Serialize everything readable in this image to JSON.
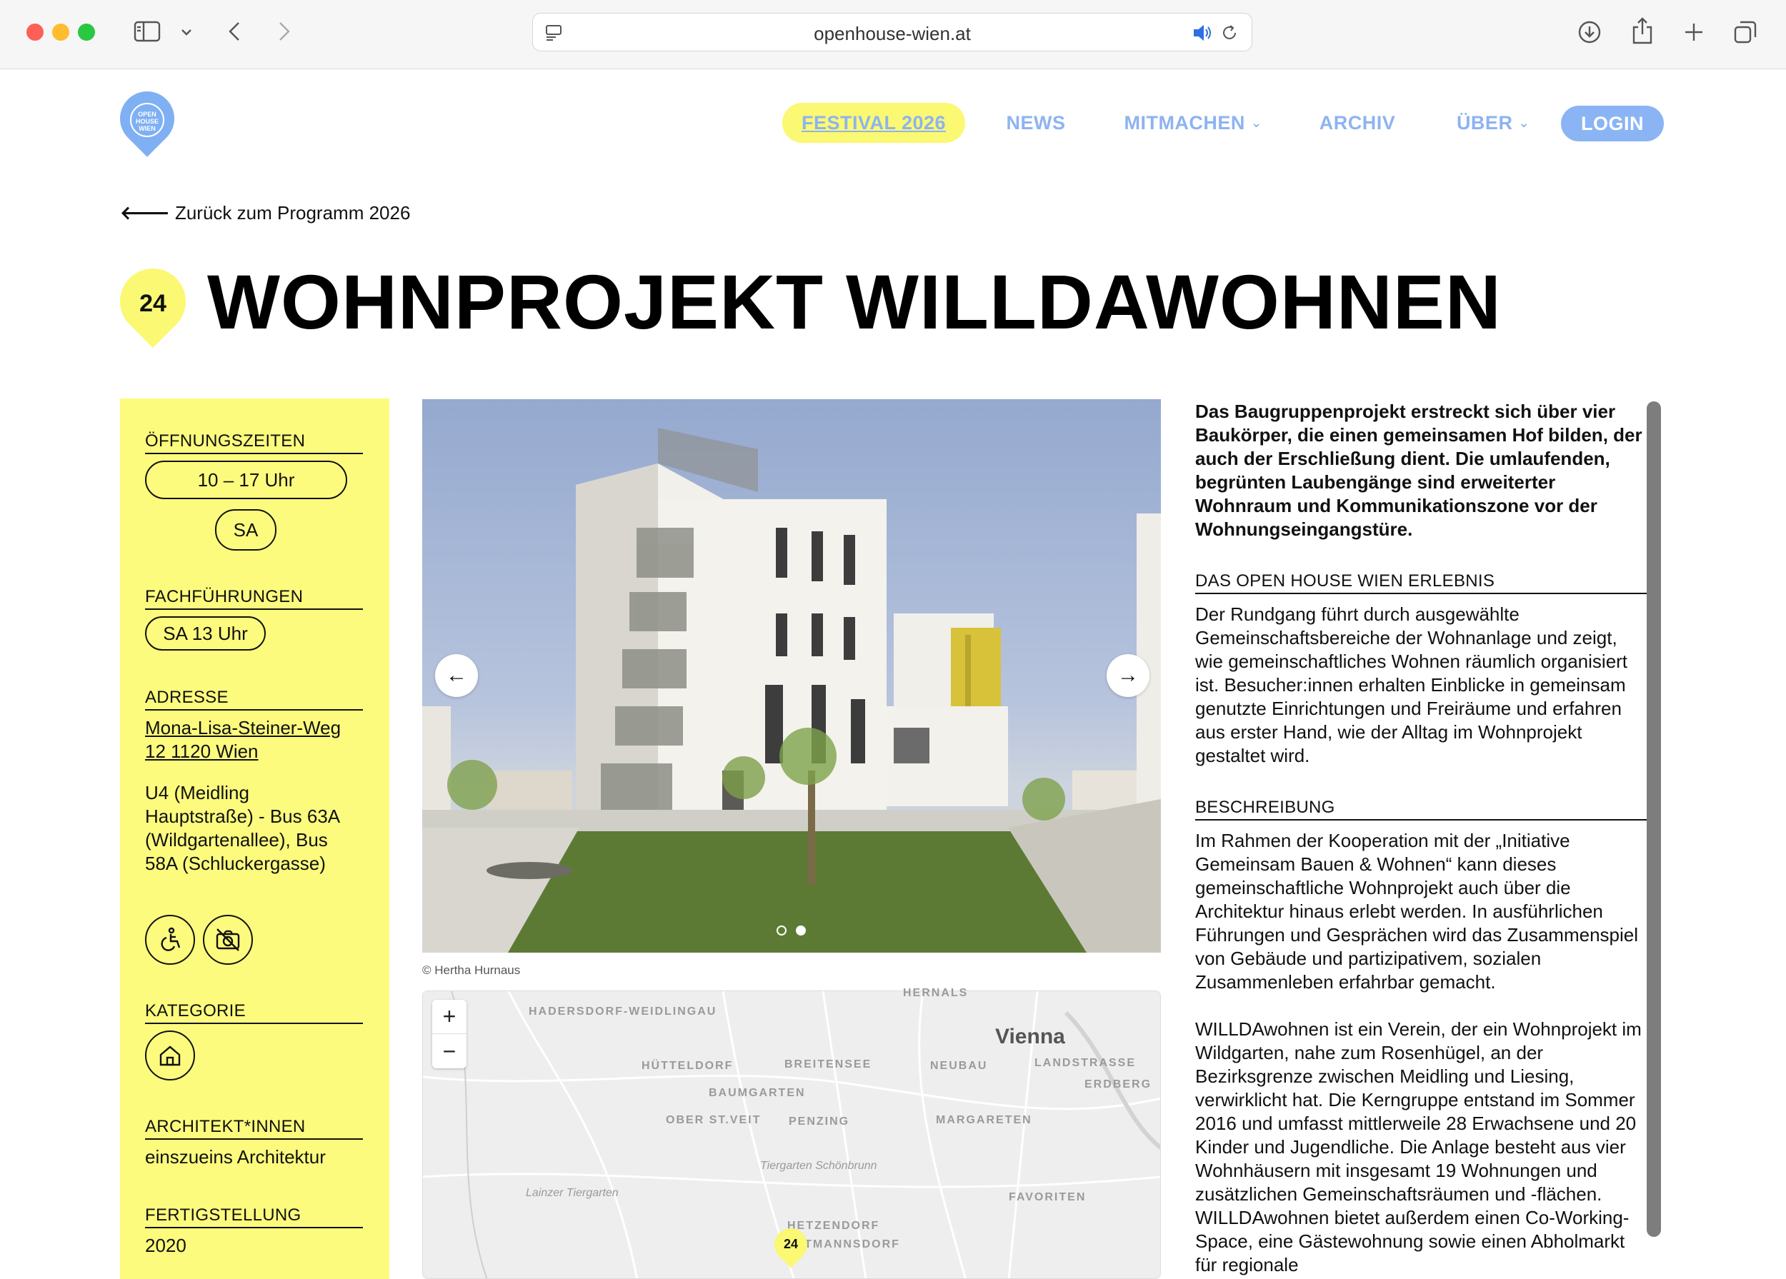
{
  "browser": {
    "url": "openhouse-wien.at",
    "icons": [
      "sidebar-icon",
      "chevron-down-icon",
      "back-icon",
      "forward-icon",
      "page-menu-icon",
      "speaker-icon",
      "reload-icon",
      "download-icon",
      "share-icon",
      "new-tab-icon",
      "tabs-overview-icon"
    ]
  },
  "logo": {
    "text": "OPEN HOUSE WIEN"
  },
  "nav": {
    "festival": "FESTIVAL 2026",
    "news": "NEWS",
    "mitmachen": "MITMACHEN",
    "archiv": "ARCHIV",
    "ueber": "ÜBER",
    "login": "LOGIN"
  },
  "back_link": "Zurück zum Programm 2026",
  "project": {
    "number": "24",
    "title": "WOHNPROJEKT WILLDAWOHNEN"
  },
  "info": {
    "opening_heading": "ÖFFNUNGSZEITEN",
    "opening_time": "10 – 17 Uhr",
    "opening_day": "SA",
    "tours_heading": "FACHFÜHRUNGEN",
    "tours_time": "SA 13 Uhr",
    "address_heading": "ADRESSE",
    "address_line1": "Mona-Lisa-Steiner-Weg",
    "address_line2": "12 1120 Wien",
    "transit": "U4 (Meidling Hauptstraße) - Bus 63A (Wildgartenallee), Bus 58A (Schluckergasse)",
    "accessibility_icons": [
      "wheelchair-icon",
      "no-photo-icon"
    ],
    "category_heading": "KATEGORIE",
    "category_icon": "house-icon",
    "architects_heading": "ARCHITEKT*INNEN",
    "architects": "einszueins Architektur",
    "completion_heading": "FERTIGSTELLUNG",
    "completion": "2020"
  },
  "gallery": {
    "prev": "←",
    "next": "→",
    "credit": "© Hertha Hurnaus",
    "slides": 2,
    "active_slide": 2
  },
  "map": {
    "zoom_in": "+",
    "zoom_out": "−",
    "city": "Vienna",
    "labels": [
      "HADERSDORF-WEIDLINGAU",
      "HÜTTELDORF",
      "BREITENSEE",
      "NEUBAU",
      "LANDSTRASSE",
      "ERDBERG",
      "BAUMGARTEN",
      "OBER ST.VEIT",
      "PENZING",
      "MARGARETEN",
      "Tiergarten Schönbrunn",
      "Lainzer Tiergarten",
      "FAVORITEN",
      "HETZENDORF",
      "ALTMANNSDORF",
      "HERNALS"
    ],
    "marker": "24"
  },
  "content": {
    "lead": "Das Baugruppenprojekt erstreckt sich über vier Baukörper, die einen gemeinsamen Hof bilden, der auch der Erschließung dient. Die umlaufenden, begrünten Laubengänge sind erweiterter Wohnraum und Kommunikationszone vor der Wohnungseingangstüre.",
    "experience_heading": "DAS OPEN HOUSE WIEN ERLEBNIS",
    "experience_text": "Der Rundgang führt durch ausgewählte Gemeinschaftsbereiche der Wohnanlage und zeigt, wie gemeinschaftliches Wohnen räumlich organisiert ist. Besucher:innen erhalten Einblicke in gemeinsam genutzte Einrichtungen und Freiräume und erfahren aus erster Hand, wie der Alltag im Wohnprojekt gestaltet wird.",
    "description_heading": "BESCHREIBUNG",
    "description_p1": "Im Rahmen der Kooperation mit der „Initiative Gemeinsam Bauen & Wohnen“ kann dieses gemeinschaftliche Wohnprojekt auch über die Architektur hinaus erlebt werden. In ausführlichen Führungen und Gesprächen wird das Zusammenspiel von Gebäude und partizipativem, sozialen Zusammenleben erfahrbar gemacht.",
    "description_p2": "WILLDAwohnen ist ein Verein, der ein Wohnprojekt im Wildgarten, nahe zum Rosenhügel, an der Bezirksgrenze zwischen Meidling und Liesing, verwirklicht hat. Die Kerngruppe entstand im Sommer 2016 und umfasst mittlerweile 28 Erwachsene und 20 Kinder und Jugendliche. Die Anlage besteht aus vier Wohnhäusern mit insgesamt 19 Wohnungen und zusätzlichen Gemeinschaftsräumen und -flächen. WILLDAwohnen bietet außerdem einen Co-Working-Space, eine Gästewohnung sowie einen Abholmarkt für regionale"
  }
}
